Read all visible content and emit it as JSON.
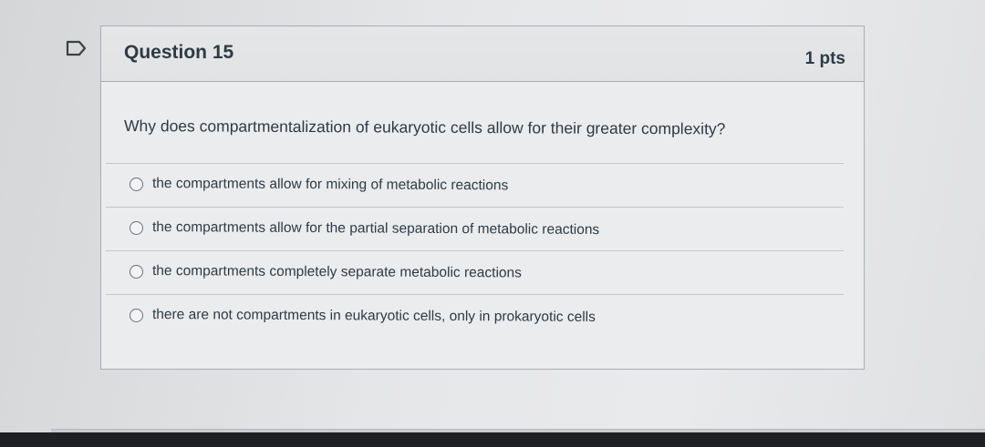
{
  "question": {
    "title": "Question 15",
    "points": "1 pts",
    "text": "Why does compartmentalization of eukaryotic cells allow for their greater complexity?",
    "answers": [
      {
        "label": "the compartments allow for mixing of metabolic reactions",
        "selected": false
      },
      {
        "label": "the compartments allow for the partial separation of metabolic reactions",
        "selected": false
      },
      {
        "label": "the compartments completely separate metabolic reactions",
        "selected": false
      },
      {
        "label": "there are not compartments in eukaryotic cells, only in prokaryotic cells",
        "selected": false
      }
    ]
  },
  "icons": {
    "flag": "flag-icon",
    "radio": "radio-button"
  },
  "colors": {
    "text": "#2d3b45",
    "border": "#a9adb2",
    "background": "#ebecee"
  }
}
